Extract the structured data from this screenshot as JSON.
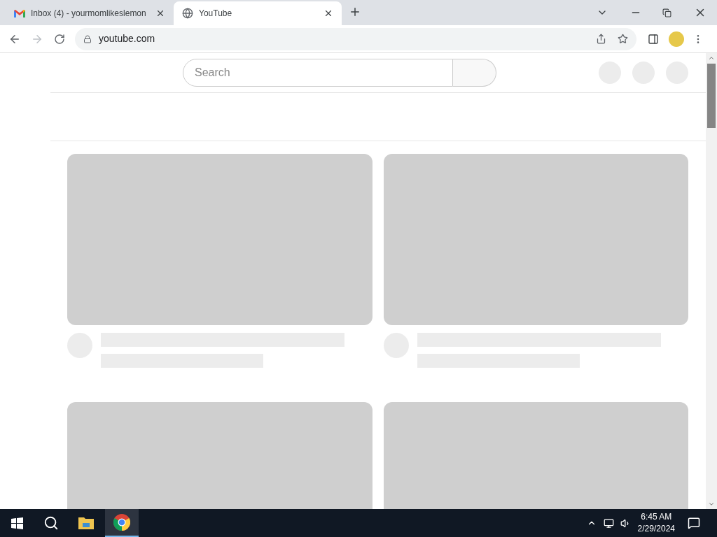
{
  "tabs": [
    {
      "kind": "mail",
      "title": "Inbox (4) - yourmomlikeslemon",
      "selected": false
    },
    {
      "kind": "globe",
      "title": "YouTube",
      "selected": true
    }
  ],
  "address": {
    "url": "youtube.com"
  },
  "search": {
    "placeholder": "Search"
  },
  "taskbar": {
    "time": "6:45 AM",
    "date": "2/29/2024"
  }
}
